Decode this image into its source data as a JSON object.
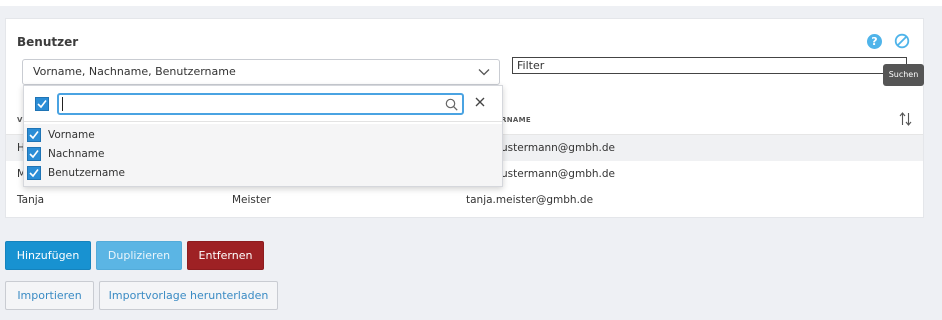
{
  "panel": {
    "title": "Benutzer",
    "help_symbol": "?",
    "column_select_value": "Vorname, Nachname, Benutzername",
    "filter_placeholder": "Filter",
    "tooltip": "Suchen"
  },
  "table": {
    "headers": [
      "Vo",
      "RNAME"
    ],
    "rows": [
      {
        "first": "H",
        "last": "",
        "email": "ustermann@gmbh.de"
      },
      {
        "first": "M",
        "last": "",
        "email": "ustermann@gmbh.de"
      },
      {
        "first": "Tanja",
        "last": "Meister",
        "email": "tanja.meister@gmbh.de"
      }
    ]
  },
  "dropdown": {
    "search_value": "",
    "items": [
      {
        "label": "Vorname",
        "checked": true
      },
      {
        "label": "Nachname",
        "checked": true
      },
      {
        "label": "Benutzername",
        "checked": true
      }
    ]
  },
  "buttons": {
    "add": "Hinzufügen",
    "duplicate": "Duplizieren",
    "remove": "Entfernen",
    "import": "Importieren",
    "template": "Importvorlage herunterladen"
  },
  "icons": {
    "help": "help-icon",
    "disable": "ban-icon",
    "chevron": "chevron-down-icon",
    "sort": "sort-icon",
    "search": "search-icon",
    "close": "close-icon",
    "check": "check-icon"
  },
  "colors": {
    "primary": "#1892d1",
    "secondary": "#5bb5e4",
    "danger": "#9e2124",
    "accent_icon": "#4fb4ea",
    "checkbox": "#2b8dd6"
  }
}
